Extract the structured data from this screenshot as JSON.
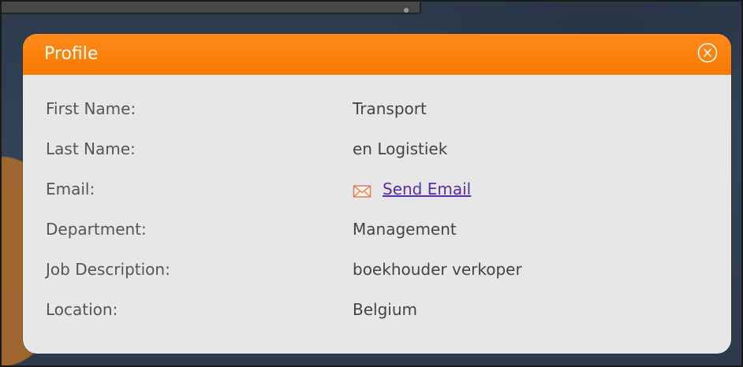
{
  "dialog": {
    "title": "Profile",
    "close_icon": "close-circle-x-icon",
    "accent_color": "#f77a00"
  },
  "fields": [
    {
      "label": "First Name:",
      "value": "Transport"
    },
    {
      "label": "Last Name:",
      "value": "en Logistiek"
    },
    {
      "label": "Email:",
      "value": "Send Email",
      "icon": "envelope-icon",
      "link_color": "#5a2ca8"
    },
    {
      "label": "Department:",
      "value": "Management"
    },
    {
      "label": "Job Description:",
      "value": "boekhouder verkoper"
    },
    {
      "label": "Location:",
      "value": "Belgium"
    }
  ]
}
